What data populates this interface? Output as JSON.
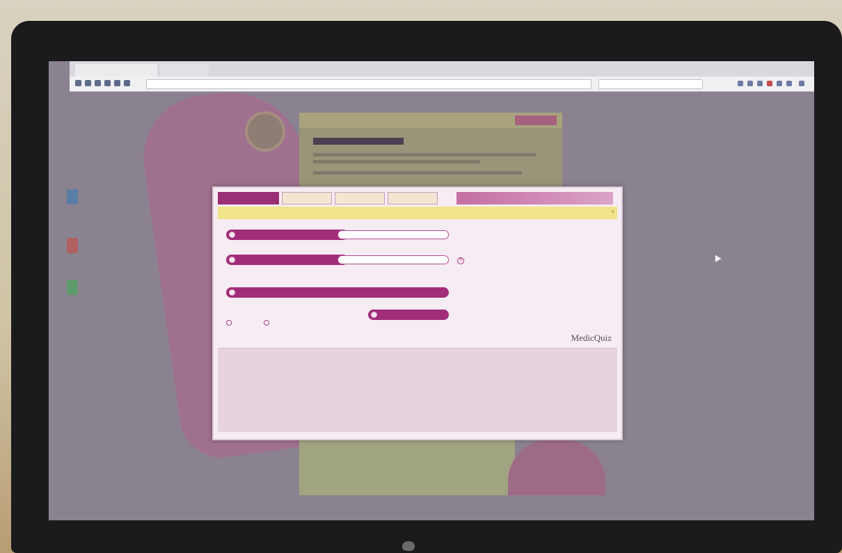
{
  "browser": {
    "tabs": [
      "",
      ""
    ],
    "url": "",
    "search_placeholder": ""
  },
  "modal": {
    "tabs": [
      "",
      "",
      "",
      ""
    ],
    "brand": "",
    "rows": [
      {
        "label": "",
        "value": ""
      },
      {
        "label": "",
        "value": ""
      }
    ],
    "wide_label": "",
    "submit_label": "",
    "options": [
      "",
      ""
    ],
    "info_glyph": "?",
    "powered_by": "",
    "logo_text": "MedicQuiz"
  },
  "colors": {
    "accent": "#a12d79",
    "banner": "#f2e48a",
    "modal_bg": "#f6ecf3"
  },
  "icons": [
    "info-icon",
    "close-icon",
    "radio-icon",
    "cursor-icon"
  ]
}
